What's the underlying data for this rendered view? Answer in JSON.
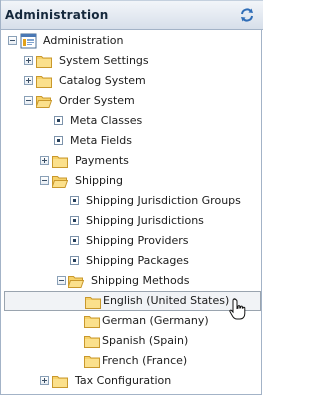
{
  "header": {
    "title": "Administration",
    "refresh_icon": "refresh-icon"
  },
  "tree": {
    "root": "Administration",
    "system_settings": "System Settings",
    "catalog_system": "Catalog System",
    "order_system": "Order System",
    "meta_classes": "Meta Classes",
    "meta_fields": "Meta Fields",
    "payments": "Payments",
    "shipping": "Shipping",
    "shipping_jurisdiction_groups": "Shipping Jurisdiction Groups",
    "shipping_jurisdictions": "Shipping Jurisdictions",
    "shipping_providers": "Shipping Providers",
    "shipping_packages": "Shipping Packages",
    "shipping_methods": "Shipping Methods",
    "english": "English (United States)",
    "german": "German (Germany)",
    "spanish": "Spanish (Spain)",
    "french": "French (France)",
    "tax_configuration": "Tax Configuration"
  },
  "colors": {
    "folder_fill": "#f6d26b",
    "folder_edge": "#c9982c",
    "selected_bg": "#f1f3f6",
    "header_border": "#a3b3c7"
  }
}
